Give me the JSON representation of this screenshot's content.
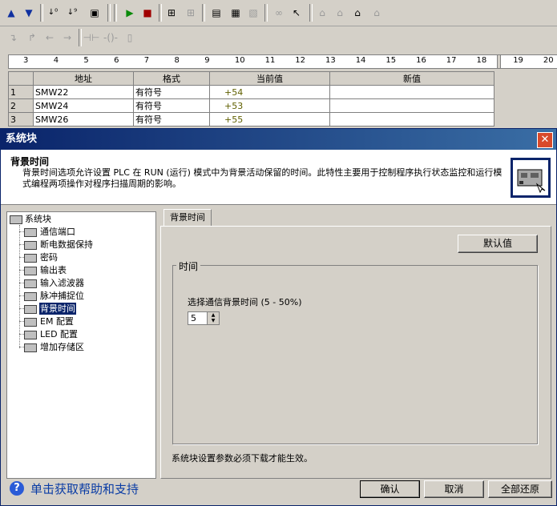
{
  "toolbar1": {
    "icons": [
      "sort-up-icon",
      "sort-down-icon",
      "sort-ascending-icon",
      "sort-descending-icon",
      "block-view-icon",
      "run-icon",
      "stop-icon",
      "network-icon",
      "network-disabled-icon",
      "chart-status-icon",
      "status-table-icon",
      "trend-icon",
      "glasses-icon",
      "cursor-icon",
      "lock-icon",
      "lock2-icon",
      "force-icon",
      "unforce-icon"
    ]
  },
  "toolbar2": {
    "icons": [
      "down-arrow-icon",
      "branch-icon",
      "left-arrow-icon",
      "right-arrow-icon",
      "contact-icon",
      "coil-icon",
      "box-icon"
    ]
  },
  "ruler": {
    "ticks": [
      "3",
      "4",
      "5",
      "6",
      "7",
      "8",
      "9",
      "10",
      "11",
      "12",
      "13",
      "14",
      "15",
      "16",
      "17",
      "18",
      "19",
      "20"
    ]
  },
  "status_table": {
    "headers": [
      "地址",
      "格式",
      "当前值",
      "新值"
    ],
    "rows": [
      {
        "num": "1",
        "addr": "SMW22",
        "fmt": "有符号",
        "cur": "+54",
        "new": ""
      },
      {
        "num": "2",
        "addr": "SMW24",
        "fmt": "有符号",
        "cur": "+53",
        "new": ""
      },
      {
        "num": "3",
        "addr": "SMW26",
        "fmt": "有符号",
        "cur": "+55",
        "new": ""
      }
    ]
  },
  "dialog": {
    "title": "系统块",
    "close": "✕",
    "header_title": "背景时间",
    "header_desc": "背景时间选项允许设置 PLC 在 RUN (运行) 模式中为背景活动保留的时间。此特性主要用于控制程序执行状态监控和运行模式编程两项操作对程序扫描周期的影响。",
    "tree": {
      "root": "系统块",
      "items": [
        "通信端口",
        "断电数据保持",
        "密码",
        "输出表",
        "输入滤波器",
        "脉冲捕捉位",
        "背景时间",
        "EM 配置",
        "LED 配置",
        "增加存储区"
      ],
      "selected_index": 6
    },
    "tab": "背景时间",
    "default_btn": "默认值",
    "group_label": "时间",
    "field_label": "选择通信背景时间 (5 - 50%)",
    "field_value": "5",
    "note": "系统块设置参数必须下载才能生效。",
    "help_text": "单击获取帮助和支持",
    "ok": "确认",
    "cancel": "取消",
    "restore_all": "全部还原"
  }
}
